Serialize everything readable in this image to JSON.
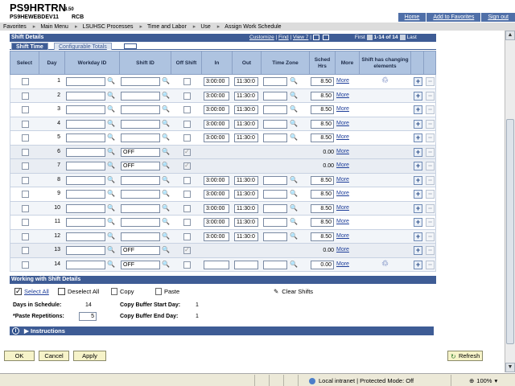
{
  "header": {
    "app_title": "PS9HRTRN",
    "version": "8.50",
    "db_name": "PS9HEWEBDEV11",
    "tag": "RCB",
    "links": [
      "Home",
      "Add to Favorites",
      "Sign out"
    ]
  },
  "nav": {
    "items": [
      "Favorites",
      "Main Menu",
      "LSUHSC Processes",
      "Time and Labor",
      "Use",
      "Assign Work Schedule"
    ]
  },
  "shift_details": {
    "title": "Shift Details",
    "customize": "Customize",
    "find": "Find",
    "view": "View 7",
    "first": "First",
    "range": "1-14 of 14",
    "last": "Last",
    "tabs": [
      "Shift Time",
      "Configurable Totals"
    ]
  },
  "grid": {
    "headers": [
      "Select",
      "Day",
      "Workday ID",
      "Shift ID",
      "Off Shift",
      "In",
      "Out",
      "Time Zone",
      "Sched Hrs",
      "More",
      "Shift has changing elements"
    ],
    "more_label": "More",
    "rows": [
      {
        "day": "1",
        "shift": "",
        "off": false,
        "in": "3:00:00",
        "out": "11:30:0",
        "hrs": "8.50",
        "more": true,
        "changing": true
      },
      {
        "day": "2",
        "shift": "",
        "off": false,
        "in": "3:00:00",
        "out": "11:30:0",
        "hrs": "8.50",
        "more": true,
        "changing": false
      },
      {
        "day": "3",
        "shift": "",
        "off": false,
        "in": "3:00:00",
        "out": "11:30:0",
        "hrs": "8.50",
        "more": true,
        "changing": false
      },
      {
        "day": "4",
        "shift": "",
        "off": false,
        "in": "3:00:00",
        "out": "11:30:0",
        "hrs": "8.50",
        "more": true,
        "changing": false
      },
      {
        "day": "5",
        "shift": "",
        "off": false,
        "in": "3:00:00",
        "out": "11:30:0",
        "hrs": "8.50",
        "more": true,
        "changing": false
      },
      {
        "day": "6",
        "shift": "OFF",
        "off": true,
        "in": "",
        "out": "",
        "hrs": "0.00",
        "more": true,
        "changing": false
      },
      {
        "day": "7",
        "shift": "OFF",
        "off": true,
        "in": "",
        "out": "",
        "hrs": "0.00",
        "more": true,
        "changing": false
      },
      {
        "day": "8",
        "shift": "",
        "off": false,
        "in": "3:00:00",
        "out": "11:30:0",
        "hrs": "8.50",
        "more": true,
        "changing": false
      },
      {
        "day": "9",
        "shift": "",
        "off": false,
        "in": "3:00:00",
        "out": "11:30:0",
        "hrs": "8.50",
        "more": true,
        "changing": false
      },
      {
        "day": "10",
        "shift": "",
        "off": false,
        "in": "3:00:00",
        "out": "11:30:0",
        "hrs": "8.50",
        "more": true,
        "changing": false
      },
      {
        "day": "11",
        "shift": "",
        "off": false,
        "in": "3:00:00",
        "out": "11:30:0",
        "hrs": "8.50",
        "more": true,
        "changing": false
      },
      {
        "day": "12",
        "shift": "",
        "off": false,
        "in": "3:00:00",
        "out": "11:30:0",
        "hrs": "8.50",
        "more": true,
        "changing": false
      },
      {
        "day": "13",
        "shift": "OFF",
        "off": true,
        "in": "",
        "out": "",
        "hrs": "0.00",
        "more": true,
        "changing": false
      },
      {
        "day": "14",
        "shift": "OFF",
        "off": false,
        "in": "",
        "out": "",
        "hrs": "0.00",
        "more": true,
        "changing": true
      }
    ]
  },
  "working": {
    "title": "Working with Shift Details",
    "select_all": "Select All",
    "deselect_all": "Deselect All",
    "copy": "Copy",
    "paste": "Paste",
    "clear_shifts": "Clear Shifts",
    "days_label": "Days in Schedule:",
    "days_value": "14",
    "copy_start_label": "Copy Buffer Start Day:",
    "copy_start_value": "1",
    "paste_rep_label": "*Paste Repetitions:",
    "paste_rep_value": "5",
    "copy_end_label": "Copy Buffer End Day:",
    "copy_end_value": "1",
    "instructions": "Instructions"
  },
  "buttons": {
    "ok": "OK",
    "cancel": "Cancel",
    "apply": "Apply",
    "refresh": "Refresh"
  },
  "status": {
    "zone": "Local intranet | Protected Mode: Off",
    "zoom": "100%"
  }
}
